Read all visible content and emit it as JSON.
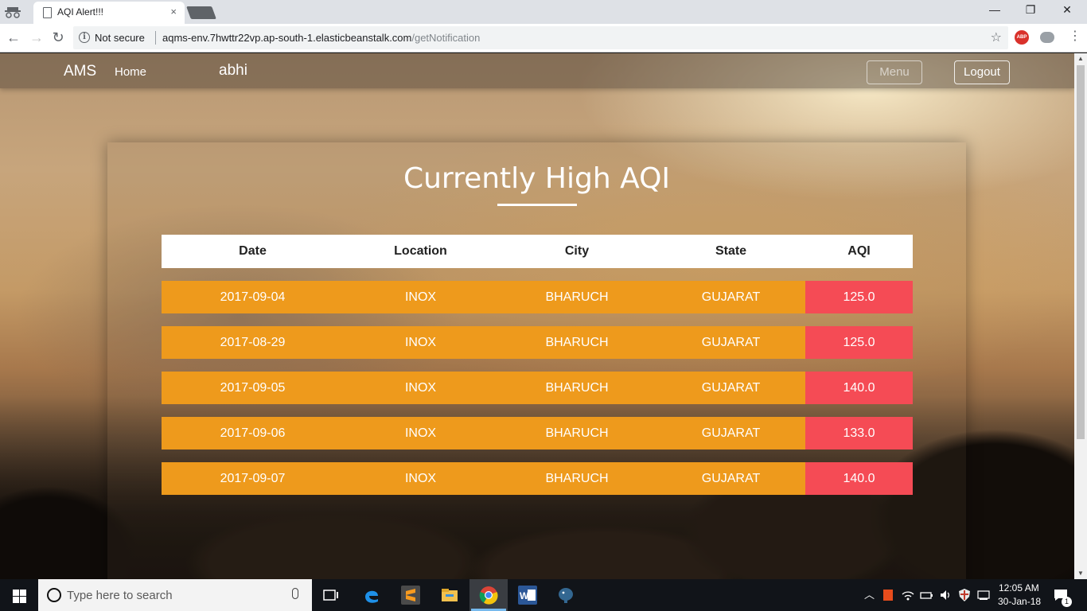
{
  "browser": {
    "tab_title": "AQI Alert!!!",
    "tab_close": "×",
    "back": "←",
    "forward": "→",
    "reload": "↻",
    "security_label": "Not secure",
    "url_host": "aqms-env.7hwttr22vp.ap-south-1.elasticbeanstalk.com",
    "url_path": "/getNotification",
    "bookmark_star": "☆",
    "extension_abp": "ABP",
    "menu_dots": "⋮",
    "window_minimize": "—",
    "window_restore": "❐",
    "window_close": "✕",
    "scroll_up": "▲",
    "scroll_down": "▼"
  },
  "navbar": {
    "brand": "AMS",
    "home": "Home",
    "user": "abhi",
    "menu_button": "Menu",
    "logout_button": "Logout"
  },
  "main": {
    "title": "Currently High AQI",
    "table": {
      "headers": [
        "Date",
        "Location",
        "City",
        "State",
        "AQI"
      ],
      "rows": [
        [
          "2017-09-04",
          "INOX",
          "BHARUCH",
          "GUJARAT",
          "125.0"
        ],
        [
          "2017-08-29",
          "INOX",
          "BHARUCH",
          "GUJARAT",
          "125.0"
        ],
        [
          "2017-09-05",
          "INOX",
          "BHARUCH",
          "GUJARAT",
          "140.0"
        ],
        [
          "2017-09-06",
          "INOX",
          "BHARUCH",
          "GUJARAT",
          "133.0"
        ],
        [
          "2017-09-07",
          "INOX",
          "BHARUCH",
          "GUJARAT",
          "140.0"
        ]
      ]
    }
  },
  "colors": {
    "row_bg": "#ee9a1c",
    "aqi_bg": "#f54b55",
    "header_bg": "#ffffff"
  },
  "taskbar": {
    "search_placeholder": "Type here to search",
    "time": "12:05 AM",
    "date": "30-Jan-18",
    "notification_count": "1",
    "apps": [
      "task-view-icon",
      "edge-icon",
      "sublime-icon",
      "file-explorer-icon",
      "chrome-icon",
      "word-icon",
      "postgres-icon"
    ],
    "tray_icons": [
      "chevron-up-icon",
      "office-icon",
      "wifi-icon",
      "power-icon",
      "volume-icon",
      "shield-icon",
      "keyboard-icon",
      "action-center-icon"
    ]
  }
}
